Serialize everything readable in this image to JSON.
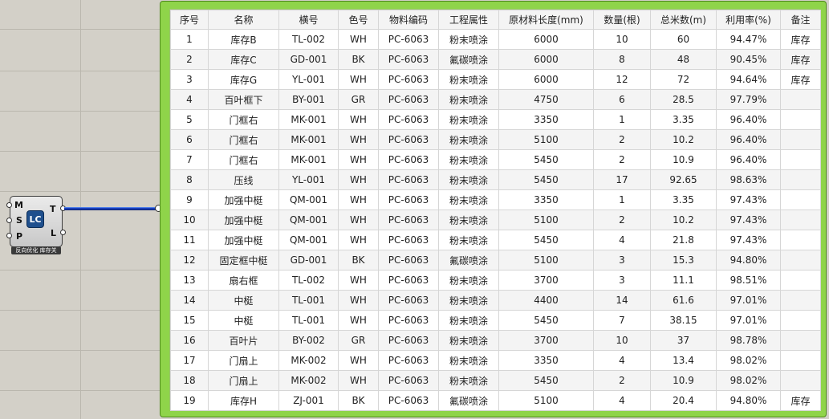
{
  "node": {
    "inputs": [
      "M",
      "S",
      "P"
    ],
    "outputs": [
      "T",
      "L"
    ],
    "icon_text": "LC",
    "label": "反向优化 库存关"
  },
  "table": {
    "headers": [
      "序号",
      "名称",
      "横号",
      "色号",
      "物料编码",
      "工程属性",
      "原材料长度(mm)",
      "数量(根)",
      "总米数(m)",
      "利用率(%)",
      "备注"
    ],
    "rows": [
      [
        "1",
        "库存B",
        "TL-002",
        "WH",
        "PC-6063",
        "粉末喷涂",
        "6000",
        "10",
        "60",
        "94.47%",
        "库存"
      ],
      [
        "2",
        "库存C",
        "GD-001",
        "BK",
        "PC-6063",
        "氟碳喷涂",
        "6000",
        "8",
        "48",
        "90.45%",
        "库存"
      ],
      [
        "3",
        "库存G",
        "YL-001",
        "WH",
        "PC-6063",
        "粉末喷涂",
        "6000",
        "12",
        "72",
        "94.64%",
        "库存"
      ],
      [
        "4",
        "百叶框下",
        "BY-001",
        "GR",
        "PC-6063",
        "粉末喷涂",
        "4750",
        "6",
        "28.5",
        "97.79%",
        ""
      ],
      [
        "5",
        "门框右",
        "MK-001",
        "WH",
        "PC-6063",
        "粉末喷涂",
        "3350",
        "1",
        "3.35",
        "96.40%",
        ""
      ],
      [
        "6",
        "门框右",
        "MK-001",
        "WH",
        "PC-6063",
        "粉末喷涂",
        "5100",
        "2",
        "10.2",
        "96.40%",
        ""
      ],
      [
        "7",
        "门框右",
        "MK-001",
        "WH",
        "PC-6063",
        "粉末喷涂",
        "5450",
        "2",
        "10.9",
        "96.40%",
        ""
      ],
      [
        "8",
        "压线",
        "YL-001",
        "WH",
        "PC-6063",
        "粉末喷涂",
        "5450",
        "17",
        "92.65",
        "98.63%",
        ""
      ],
      [
        "9",
        "加强中梃",
        "QM-001",
        "WH",
        "PC-6063",
        "粉末喷涂",
        "3350",
        "1",
        "3.35",
        "97.43%",
        ""
      ],
      [
        "10",
        "加强中梃",
        "QM-001",
        "WH",
        "PC-6063",
        "粉末喷涂",
        "5100",
        "2",
        "10.2",
        "97.43%",
        ""
      ],
      [
        "11",
        "加强中梃",
        "QM-001",
        "WH",
        "PC-6063",
        "粉末喷涂",
        "5450",
        "4",
        "21.8",
        "97.43%",
        ""
      ],
      [
        "12",
        "固定框中梃",
        "GD-001",
        "BK",
        "PC-6063",
        "氟碳喷涂",
        "5100",
        "3",
        "15.3",
        "94.80%",
        ""
      ],
      [
        "13",
        "扇右框",
        "TL-002",
        "WH",
        "PC-6063",
        "粉末喷涂",
        "3700",
        "3",
        "11.1",
        "98.51%",
        ""
      ],
      [
        "14",
        "中梃",
        "TL-001",
        "WH",
        "PC-6063",
        "粉末喷涂",
        "4400",
        "14",
        "61.6",
        "97.01%",
        ""
      ],
      [
        "15",
        "中梃",
        "TL-001",
        "WH",
        "PC-6063",
        "粉末喷涂",
        "5450",
        "7",
        "38.15",
        "97.01%",
        ""
      ],
      [
        "16",
        "百叶片",
        "BY-002",
        "GR",
        "PC-6063",
        "粉末喷涂",
        "3700",
        "10",
        "37",
        "98.78%",
        ""
      ],
      [
        "17",
        "门扇上",
        "MK-002",
        "WH",
        "PC-6063",
        "粉末喷涂",
        "3350",
        "4",
        "13.4",
        "98.02%",
        ""
      ],
      [
        "18",
        "门扇上",
        "MK-002",
        "WH",
        "PC-6063",
        "粉末喷涂",
        "5450",
        "2",
        "10.9",
        "98.02%",
        ""
      ],
      [
        "19",
        "库存H",
        "ZJ-001",
        "BK",
        "PC-6063",
        "氟碳喷涂",
        "5100",
        "4",
        "20.4",
        "94.80%",
        "库存"
      ]
    ]
  },
  "colors": {
    "canvas": "#d3d0c8",
    "panel_green": "#8fd44a",
    "wire_blue": "#1a3fb8",
    "icon_blue": "#1f4f8d"
  }
}
